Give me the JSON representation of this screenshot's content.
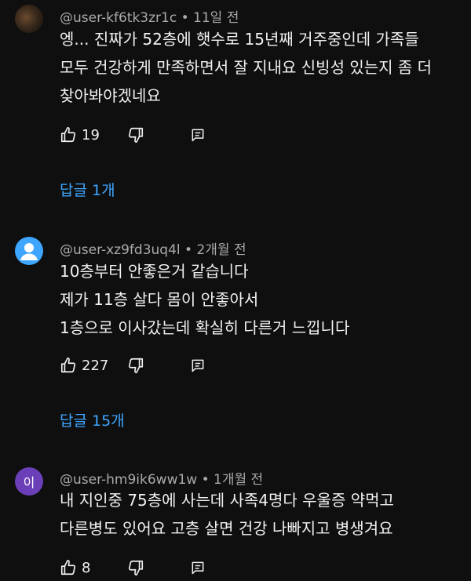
{
  "comments": [
    {
      "author": "@user-kf6tk3zr1c",
      "time": "11일 전",
      "text": "엥... 진짜가 52층에 햇수로 15년째 거주중인데 가족들\n모두 건강하게 만족하면서 잘 지내요 신빙성 있는지 좀 더\n찾아봐야겠네요",
      "likes": "19",
      "replies": "답글 1개",
      "avatar_type": "photo"
    },
    {
      "author": "@user-xz9fd3uq4l",
      "time": "2개월 전",
      "text": "10층부터 안좋은거 같습니다\n제가 11층 살다 몸이 안좋아서\n1층으로 이사갔는데 확실히 다른거 느낍니다",
      "likes": "227",
      "replies": "답글 15개",
      "avatar_type": "default"
    },
    {
      "author": "@user-hm9ik6ww1w",
      "time": "1개월 전",
      "text": "내 지인중 75층에 사는데 사족4명다 우울증 약먹고\n다른병도 있어요  고층 살면 건강 나빠지고  병생겨요",
      "likes": "8",
      "avatar_letter": "이",
      "avatar_type": "letter"
    }
  ],
  "separator": "•",
  "colors": {
    "background": "#0f0f0f",
    "link": "#3ea6ff",
    "meta": "#aaaaaa",
    "text": "#f1f1f1"
  },
  "icons": [
    "thumbs-up-icon",
    "thumbs-down-icon",
    "reply-icon"
  ]
}
